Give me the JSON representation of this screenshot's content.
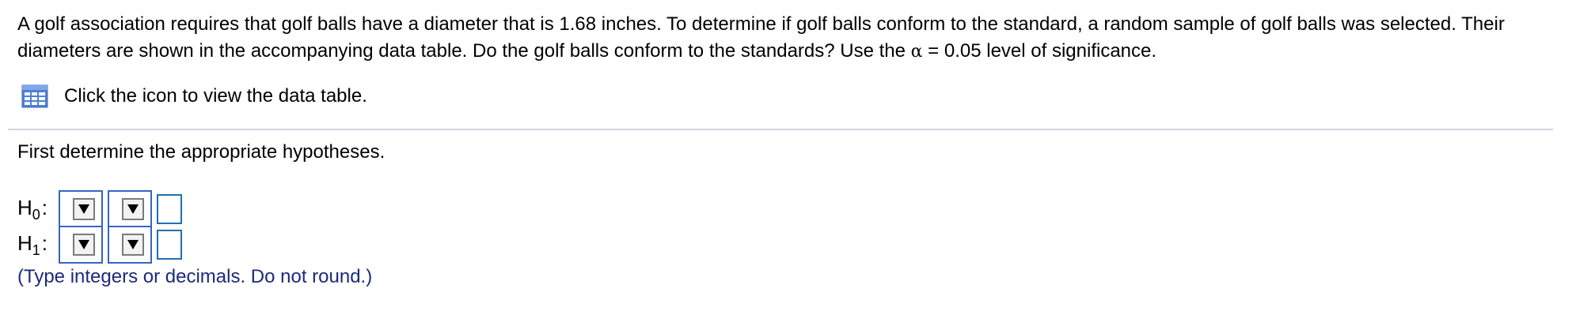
{
  "question": {
    "text": "A golf association requires that golf balls have a diameter that is 1.68 inches. To determine if golf balls conform to the standard, a random sample of golf balls was selected. Their diameters are shown in the accompanying data table. Do the golf balls conform to the standards? Use the ",
    "alpha_symbol": "α",
    "alpha_rest": " = 0.05 level of significance."
  },
  "data_table_link": {
    "icon": "data-table-icon",
    "text": "Click the icon to view the data table."
  },
  "part1": {
    "prompt": "First determine the appropriate hypotheses.",
    "rows": [
      {
        "label": "H",
        "sub": "0",
        "colon": ":",
        "dropdown1_value": "",
        "dropdown2_value": "",
        "input_value": ""
      },
      {
        "label": "H",
        "sub": "1",
        "colon": ":",
        "dropdown1_value": "",
        "dropdown2_value": "",
        "input_value": ""
      }
    ],
    "hint": "(Type integers or decimals. Do not round.)"
  },
  "colors": {
    "dropdown_border": "#3a63c3",
    "input_border": "#1f6fb3",
    "hint_text": "#1d2a7a",
    "icon_blue": "#4f7fd6"
  }
}
